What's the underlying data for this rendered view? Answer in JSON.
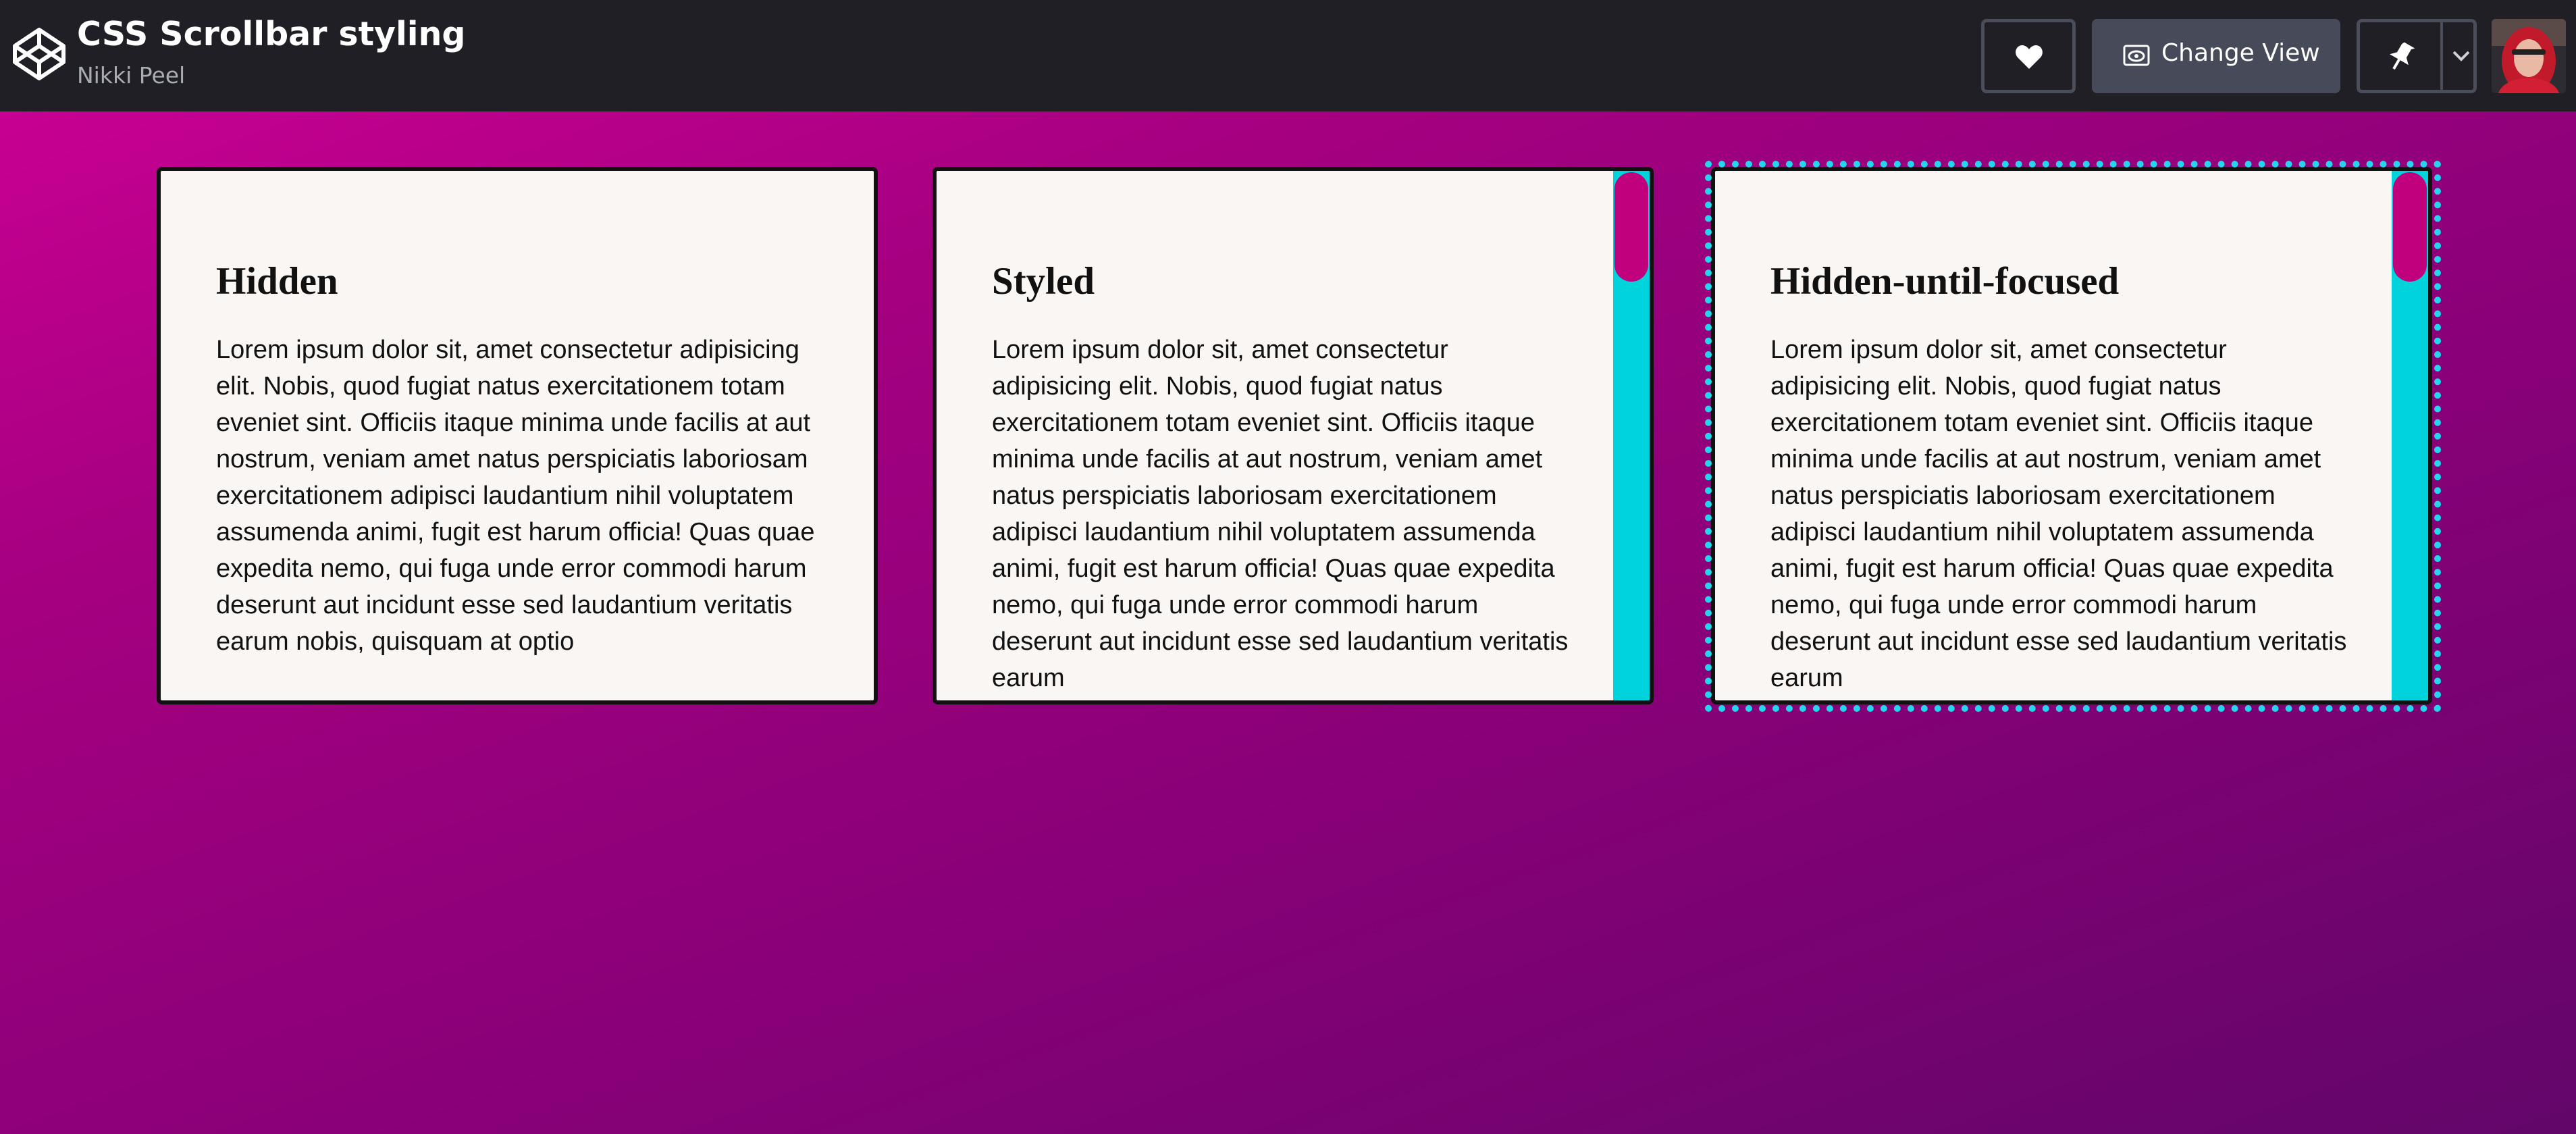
{
  "header": {
    "title": "CSS Scrollbar styling",
    "author": "Nikki Peel",
    "change_view_label": "Change View",
    "icons": {
      "logo": "codepen-logo-icon",
      "heart": "heart-icon",
      "view": "eye-icon",
      "pin": "pin-icon",
      "dropdown": "chevron-down-icon"
    }
  },
  "cards": [
    {
      "title": "Hidden",
      "text": "Lorem ipsum dolor sit, amet consectetur adipisicing elit. Nobis, quod fugiat natus exercitationem totam eveniet sint. Officiis itaque minima unde facilis at aut nostrum, veniam amet natus perspiciatis laboriosam exercitationem adipisci laudantium nihil voluptatem assumenda animi, fugit est harum officia! Quas quae expedita nemo, qui fuga unde error commodi harum deserunt aut incidunt esse sed laudantium veritatis earum nobis, quisquam at optio",
      "scrollbar": "hidden"
    },
    {
      "title": "Styled",
      "text": "Lorem ipsum dolor sit, amet consectetur adipisicing elit. Nobis, quod fugiat natus exercitationem totam eveniet sint. Officiis itaque minima unde facilis at aut nostrum, veniam amet natus perspiciatis laboriosam exercitationem adipisci laudantium nihil voluptatem assumenda animi, fugit est harum officia! Quas quae expedita nemo, qui fuga unde error commodi harum deserunt aut incidunt esse sed laudantium veritatis earum",
      "scrollbar": "styled"
    },
    {
      "title": "Hidden-until-focused",
      "text": "Lorem ipsum dolor sit, amet consectetur adipisicing elit. Nobis, quod fugiat natus exercitationem totam eveniet sint. Officiis itaque minima unde facilis at aut nostrum, veniam amet natus perspiciatis laboriosam exercitationem adipisci laudantium nihil voluptatem assumenda animi, fugit est harum officia! Quas quae expedita nemo, qui fuga unde error commodi harum deserunt aut incidunt esse sed laudantium veritatis earum",
      "scrollbar": "styled",
      "focused": true
    }
  ],
  "colors": {
    "background_top_left": "#cf0096",
    "background_bottom_right": "#62066a",
    "header_bg": "#1f1f25",
    "card_bg": "#faf6f3",
    "scroll_track": "#00d3dc",
    "scroll_thumb": "#c1007e",
    "focus_ring": "#22d6ee"
  }
}
